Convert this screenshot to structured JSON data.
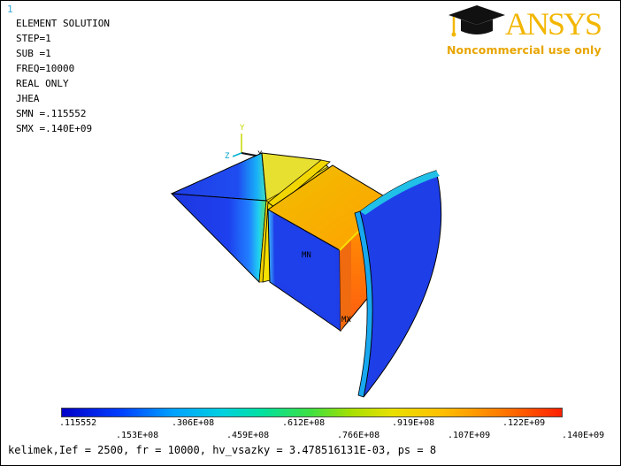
{
  "window_number": "1",
  "info_lines": [
    "ELEMENT SOLUTION",
    "",
    "STEP=1",
    "SUB =1",
    "FREQ=10000",
    "REAL ONLY",
    "JHEA",
    "SMN =.115552",
    "SMX =.140E+09"
  ],
  "logo": {
    "brand": "ANSYS",
    "tagline": "Noncommercial use only",
    "brand_color": "#f2b600"
  },
  "triad": {
    "y_label": "Y",
    "z_label": "Z",
    "x_label": "X"
  },
  "markers": {
    "min": "MN",
    "max": "MX"
  },
  "legend": {
    "top_ticks": [
      ".115552",
      ".306E+08",
      ".612E+08",
      ".919E+08",
      ".122E+09"
    ],
    "bottom_ticks": [
      ".153E+08",
      ".459E+08",
      ".766E+08",
      ".107E+09",
      ".140E+09"
    ],
    "min_color": "#0000c8",
    "max_color": "#ff2000"
  },
  "command_line": "kelimek,Ief = 2500, fr = 10000, hv_vsazky = 3.478516131E-03, ps = 8"
}
